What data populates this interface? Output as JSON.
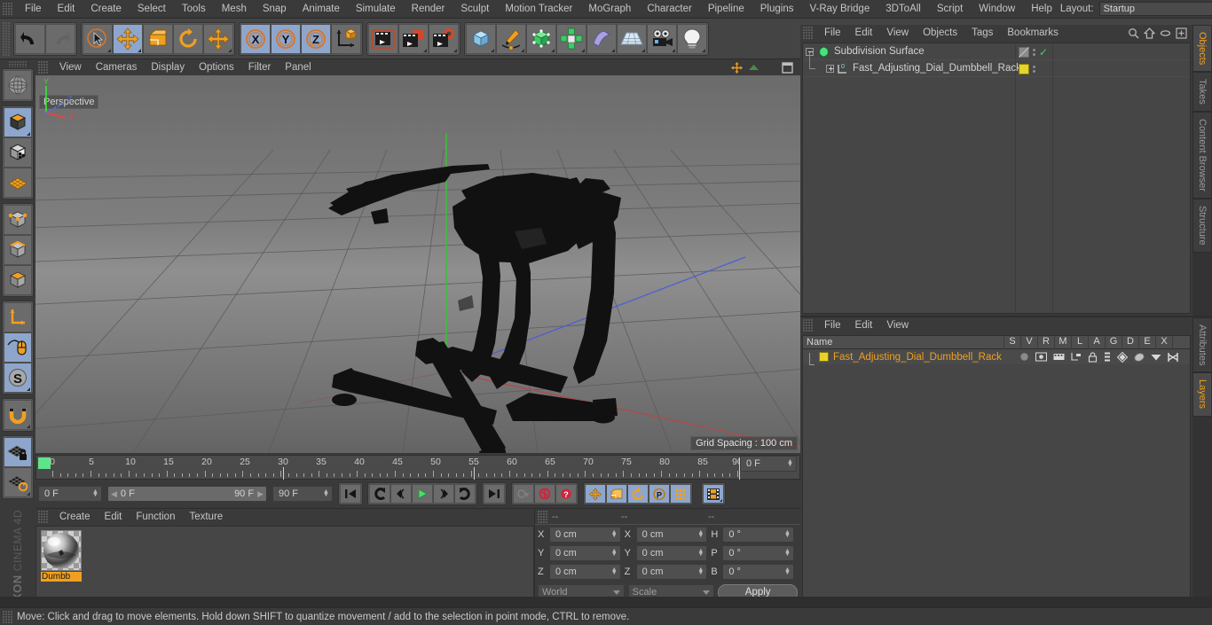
{
  "app": {
    "vendor": "MAXON",
    "product": "CINEMA 4D"
  },
  "menubar": {
    "items": [
      "File",
      "Edit",
      "Create",
      "Select",
      "Tools",
      "Mesh",
      "Snap",
      "Animate",
      "Simulate",
      "Render",
      "Sculpt",
      "Motion Tracker",
      "MoGraph",
      "Character",
      "Pipeline",
      "Plugins",
      "V-Ray Bridge",
      "3DToAll",
      "Script",
      "Window",
      "Help"
    ],
    "layout_label": "Layout:",
    "layout_value": "Startup",
    "search_icon": "magnifier-icon"
  },
  "toolbar": {
    "groups": [
      {
        "name": "history",
        "buttons": [
          {
            "name": "undo-button",
            "icon": "undo-icon",
            "active": false
          },
          {
            "name": "redo-button",
            "icon": "redo-icon",
            "active": false
          }
        ]
      },
      {
        "name": "transform",
        "buttons": [
          {
            "name": "select-tool-button",
            "icon": "cursor-select-icon",
            "active": false
          },
          {
            "name": "move-tool-button",
            "icon": "move-arrows-icon",
            "active": true
          },
          {
            "name": "scale-tool-button",
            "icon": "scale-box-icon",
            "active": false
          },
          {
            "name": "rotate-tool-button",
            "icon": "rotate-arc-icon",
            "active": false
          },
          {
            "name": "dynamic-place-button",
            "icon": "move-arrows-icon",
            "active": false
          }
        ]
      },
      {
        "name": "axis-lock",
        "buttons": [
          {
            "name": "lock-x-button",
            "icon": "axis-x-icon",
            "label": "X",
            "active": true
          },
          {
            "name": "lock-y-button",
            "icon": "axis-y-icon",
            "label": "Y",
            "active": true
          },
          {
            "name": "lock-z-button",
            "icon": "axis-z-icon",
            "label": "Z",
            "active": true
          },
          {
            "name": "world-object-coord-button",
            "icon": "world-coordinate-icon",
            "active": false
          }
        ]
      },
      {
        "name": "render",
        "buttons": [
          {
            "name": "render-view-button",
            "icon": "render-view-icon",
            "active": false
          },
          {
            "name": "render-to-picture-viewer-button",
            "icon": "render-picture-viewer-icon",
            "active": false
          },
          {
            "name": "render-settings-button",
            "icon": "render-settings-icon",
            "active": false
          }
        ]
      },
      {
        "name": "create",
        "buttons": [
          {
            "name": "add-cube-button",
            "icon": "cube-icon",
            "active": false
          },
          {
            "name": "add-spline-button",
            "icon": "pen-spline-icon",
            "active": false
          },
          {
            "name": "add-generator-button",
            "icon": "green-cube-generator-icon",
            "active": false
          },
          {
            "name": "add-array-button",
            "icon": "array-clone-icon",
            "active": false
          },
          {
            "name": "add-deformer-button",
            "icon": "bend-deformer-icon",
            "active": false
          },
          {
            "name": "add-scene-object-button",
            "icon": "floor-grid-icon",
            "active": false
          },
          {
            "name": "add-camera-button",
            "icon": "camera-icon",
            "active": false
          },
          {
            "name": "add-light-button",
            "icon": "light-bulb-icon",
            "active": false
          }
        ]
      }
    ]
  },
  "lefttools": {
    "buttons": [
      {
        "name": "viewport-render-region-button",
        "icon": "globe-wire-icon",
        "active": false
      },
      {
        "name": "model-mode-button",
        "icon": "model-cube-icon",
        "active": true
      },
      {
        "name": "texture-mode-button",
        "icon": "texture-checker-cube-icon",
        "active": false
      },
      {
        "name": "workplane-mode-button",
        "icon": "workplane-grid-icon",
        "active": false
      },
      {
        "name": "point-mode-button",
        "icon": "points-cube-icon",
        "active": false
      },
      {
        "name": "edge-mode-button",
        "icon": "edges-cube-icon",
        "active": false
      },
      {
        "name": "polygon-mode-button",
        "icon": "polygon-cube-icon",
        "active": false
      },
      {
        "name": "axis-mode-button",
        "icon": "axis-l-icon",
        "active": false
      },
      {
        "name": "viewport-solo-button",
        "icon": "mouse-icon",
        "active": true
      },
      {
        "name": "soft-selection-button",
        "icon": "soft-s-icon",
        "active": true
      },
      {
        "name": "snap-magnet-button",
        "icon": "magnet-snap-icon",
        "active": false
      },
      {
        "name": "workplane-lock-button",
        "icon": "grid-lock-icon",
        "active": true
      },
      {
        "name": "workplane-rotate-button",
        "icon": "grid-rotate-icon",
        "active": false
      }
    ]
  },
  "viewport": {
    "menu_items": [
      "View",
      "Cameras",
      "Display",
      "Options",
      "Filter",
      "Panel"
    ],
    "view_label": "Perspective",
    "grid_spacing": "Grid Spacing : 100 cm",
    "axis_gizmo": {
      "x": "X",
      "y": "Y",
      "z": "Z",
      "x_color": "#e04646",
      "y_color": "#4fcf4f",
      "z_color": "#4f6fe0"
    },
    "model": {
      "name": "Fast_Adjusting_Dial_Dumbbell_Rack",
      "color": "#121212"
    },
    "nav_icons": [
      "pan-icon",
      "zoom-icon",
      "rotate-icon",
      "maximize-icon"
    ]
  },
  "timeline": {
    "ticks": [
      0,
      5,
      10,
      15,
      20,
      25,
      30,
      35,
      40,
      45,
      50,
      55,
      60,
      65,
      70,
      75,
      80,
      85,
      90
    ],
    "current_frame_field": "0 F",
    "current_frame_field2": "0 F",
    "range_start": "0 F",
    "range_end": "90 F",
    "end_frame_field": "90 F",
    "playhead_frames": [
      30,
      60,
      90
    ],
    "transport": [
      {
        "name": "goto-start-button",
        "icon": "skip-start-icon"
      },
      {
        "name": "previous-key-button",
        "icon": "prev-key-icon"
      },
      {
        "name": "step-back-button",
        "icon": "step-back-icon"
      },
      {
        "name": "play-button",
        "icon": "play-icon",
        "color": "#4fdc6e"
      },
      {
        "name": "step-forward-button",
        "icon": "step-forward-icon"
      },
      {
        "name": "next-key-button",
        "icon": "next-key-icon"
      },
      {
        "name": "goto-end-button",
        "icon": "skip-end-icon"
      }
    ],
    "record_group": [
      {
        "name": "autokey-button",
        "icon": "key-icon"
      },
      {
        "name": "record-active-objects-button",
        "icon": "record-circle-icon",
        "color": "#d2243a"
      },
      {
        "name": "record-help-button",
        "icon": "question-circle-icon",
        "color": "#d2243a"
      }
    ],
    "keyframe_group": [
      {
        "name": "key-position-button",
        "icon": "move-arrows-icon",
        "active": true
      },
      {
        "name": "key-scale-button",
        "icon": "scale-box-icon",
        "active": true
      },
      {
        "name": "key-rotation-button",
        "icon": "rotate-arc-icon",
        "active": true
      },
      {
        "name": "key-parameter-button",
        "icon": "parameter-p-icon",
        "active": true
      },
      {
        "name": "key-pla-button",
        "icon": "point-level-animation-icon",
        "active": true
      }
    ],
    "extra_button": {
      "name": "timeline-toggle-button",
      "icon": "film-strip-icon",
      "active": true
    }
  },
  "material_manager": {
    "menu_items": [
      "Create",
      "Edit",
      "Function",
      "Texture"
    ],
    "materials": [
      {
        "name": "Dumbbell",
        "display_name": "Dumbb",
        "preview": "chrome-sphere-preview"
      }
    ]
  },
  "coordinates": {
    "header": [
      "--",
      "--",
      "--"
    ],
    "position": {
      "label_x": "X",
      "label_y": "Y",
      "label_z": "Z",
      "x": "0 cm",
      "y": "0 cm",
      "z": "0 cm"
    },
    "size": {
      "label_x": "X",
      "label_y": "Y",
      "label_z": "Z",
      "x": "0 cm",
      "y": "0 cm",
      "z": "0 cm"
    },
    "rotation": {
      "label_h": "H",
      "label_p": "P",
      "label_b": "B",
      "h": "0 °",
      "p": "0 °",
      "b": "0 °"
    },
    "coord_system": "World",
    "mode": "Scale",
    "apply_label": "Apply"
  },
  "object_manager": {
    "menu_items": [
      "File",
      "Edit",
      "View",
      "Objects",
      "Tags",
      "Bookmarks"
    ],
    "icons": [
      "magnifier-icon",
      "home-icon",
      "ellipse-icon",
      "plus-box-icon"
    ],
    "rows": [
      {
        "name": "Subdivision Surface",
        "icon": "subdivision-surface-icon",
        "expander": "minus",
        "indent": 0,
        "tag": "display-tag",
        "tag_color": "#8a8a8a",
        "enabled": true,
        "check": "✓"
      },
      {
        "name": "Fast_Adjusting_Dial_Dumbbell_Rack",
        "icon": "polygon-object-icon",
        "expander": "plus",
        "indent": 1,
        "tag": "material-tag",
        "tag_color": "#e8d22a",
        "enabled": true,
        "check": ""
      }
    ]
  },
  "layer_manager": {
    "menu_items": [
      "File",
      "Edit",
      "View"
    ],
    "columns": [
      "Name",
      "S",
      "V",
      "R",
      "M",
      "L",
      "A",
      "G",
      "D",
      "E",
      "X"
    ],
    "rows": [
      {
        "name": "Fast_Adjusting_Dial_Dumbbell_Rack",
        "color": "#e8d22a",
        "icons": [
          "solo-dot-icon",
          "visible-icon",
          "render-icon",
          "manager-icon",
          "lock-icon",
          "animation-icon",
          "generator-icon",
          "deformer-icon",
          "expression-icon",
          "xpresso-icon"
        ]
      }
    ]
  },
  "right_tabs_top": [
    {
      "label": "Objects",
      "active": true
    },
    {
      "label": "Takes",
      "active": false
    },
    {
      "label": "Content Browser",
      "active": false
    },
    {
      "label": "Structure",
      "active": false
    }
  ],
  "right_tabs_bottom": [
    {
      "label": "Attributes",
      "active": false
    },
    {
      "label": "Layers",
      "active": true
    }
  ],
  "statusbar": {
    "text": "Move: Click and drag to move elements. Hold down SHIFT to quantize movement / add to the selection in point mode, CTRL to remove."
  },
  "colors": {
    "panel_bg": "#3a3a3a",
    "toolbar_bg": "#444444",
    "button_bg": "#6b6b6b",
    "active_blue": "#8ea6cc",
    "accent_orange": "#f0a020",
    "text": "#c8c8c8"
  }
}
